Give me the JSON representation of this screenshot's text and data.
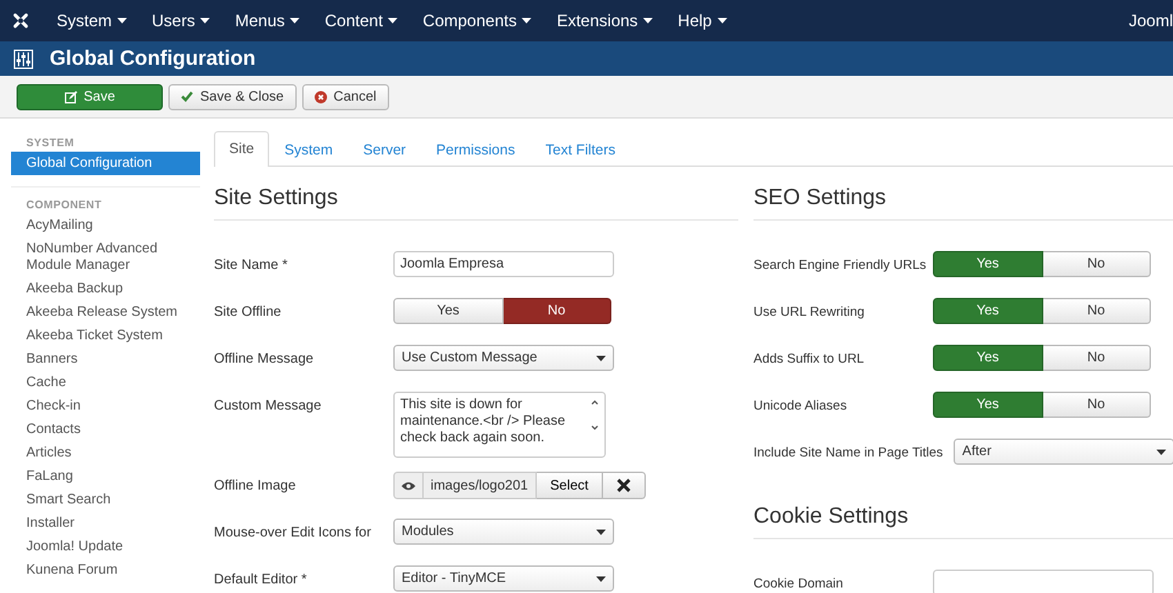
{
  "menu": {
    "items": [
      "System",
      "Users",
      "Menus",
      "Content",
      "Components",
      "Extensions",
      "Help"
    ],
    "user": "Jooml"
  },
  "header": {
    "title": "Global Configuration"
  },
  "toolbar": [
    {
      "label": "Save",
      "kind": "primary"
    },
    {
      "label": "Save & Close",
      "kind": "check"
    },
    {
      "label": "Cancel",
      "kind": "cancel"
    }
  ],
  "sidebar": [
    {
      "heading": "SYSTEM",
      "items": [
        {
          "label": "Global Configuration",
          "selected": true
        }
      ]
    },
    {
      "heading": "COMPONENT",
      "items": [
        {
          "label": "AcyMailing",
          "selected": false
        },
        {
          "label": "NoNumber Advanced Module Manager",
          "selected": false
        },
        {
          "label": "Akeeba Backup",
          "selected": false
        },
        {
          "label": "Akeeba Release System",
          "selected": false
        },
        {
          "label": "Akeeba Ticket System",
          "selected": false
        },
        {
          "label": "Banners",
          "selected": false
        },
        {
          "label": "Cache",
          "selected": false
        },
        {
          "label": "Check-in",
          "selected": false
        },
        {
          "label": "Contacts",
          "selected": false
        },
        {
          "label": "Articles",
          "selected": false
        },
        {
          "label": "FaLang",
          "selected": false
        },
        {
          "label": "Smart Search",
          "selected": false
        },
        {
          "label": "Installer",
          "selected": false
        },
        {
          "label": "Joomla! Update",
          "selected": false
        },
        {
          "label": "Kunena Forum",
          "selected": false
        }
      ]
    }
  ],
  "tabs": [
    {
      "label": "Site",
      "selected": true
    },
    {
      "label": "System",
      "selected": false
    },
    {
      "label": "Server",
      "selected": false
    },
    {
      "label": "Permissions",
      "selected": false
    },
    {
      "label": "Text Filters",
      "selected": false
    }
  ],
  "columns": [
    {
      "sections": [
        {
          "title": "Site Settings",
          "fields": [
            {
              "label": "Site Name *",
              "kind": "text",
              "value": "Joomla Empresa"
            },
            {
              "label": "Site Offline",
              "kind": "toggle",
              "options": [
                {
                  "label": "Yes",
                  "selected": false
                },
                {
                  "label": "No",
                  "selected": true
                }
              ]
            },
            {
              "label": "Offline Message",
              "kind": "select",
              "value": "Use Custom Message"
            },
            {
              "label": "Custom Message",
              "kind": "textarea",
              "value": "This site is down for maintenance.<br /> Please check back again soon."
            },
            {
              "label": "Offline Image",
              "kind": "media",
              "value": "images/logo201",
              "button": "Select"
            },
            {
              "label": "Mouse-over Edit Icons for",
              "kind": "select",
              "value": "Modules"
            },
            {
              "label": "Default Editor *",
              "kind": "select",
              "value": "Editor - TinyMCE"
            }
          ]
        }
      ]
    },
    {
      "sections": [
        {
          "title": "SEO Settings",
          "fields": [
            {
              "label": "Search Engine Friendly URLs",
              "kind": "toggle",
              "options": [
                {
                  "label": "Yes",
                  "selected": true
                },
                {
                  "label": "No",
                  "selected": false
                }
              ]
            },
            {
              "label": "Use URL Rewriting",
              "kind": "toggle",
              "options": [
                {
                  "label": "Yes",
                  "selected": true
                },
                {
                  "label": "No",
                  "selected": false
                }
              ]
            },
            {
              "label": "Adds Suffix to URL",
              "kind": "toggle",
              "options": [
                {
                  "label": "Yes",
                  "selected": true
                },
                {
                  "label": "No",
                  "selected": false
                }
              ]
            },
            {
              "label": "Unicode Aliases",
              "kind": "toggle",
              "options": [
                {
                  "label": "Yes",
                  "selected": true
                },
                {
                  "label": "No",
                  "selected": false
                }
              ]
            },
            {
              "label": "Include Site Name in Page Titles",
              "kind": "select",
              "value": "After"
            }
          ]
        },
        {
          "title": "Cookie Settings",
          "fields": [
            {
              "label": "Cookie Domain",
              "kind": "text"
            }
          ]
        }
      ]
    }
  ]
}
